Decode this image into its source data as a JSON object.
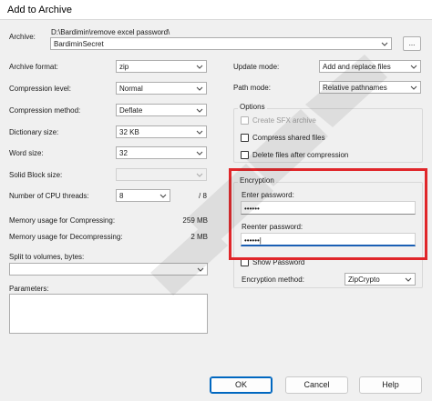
{
  "window": {
    "title": "Add to Archive"
  },
  "archive": {
    "label": "Archive:",
    "path": "D:\\Bardimin\\remove excel password\\",
    "name": "BardiminSecret",
    "browse_label": "..."
  },
  "left": {
    "format_label": "Archive format:",
    "format_value": "zip",
    "level_label": "Compression level:",
    "level_value": "Normal",
    "method_label": "Compression method:",
    "method_value": "Deflate",
    "dict_label": "Dictionary size:",
    "dict_value": "32 KB",
    "word_label": "Word size:",
    "word_value": "32",
    "solid_label": "Solid Block size:",
    "solid_value": "",
    "threads_label": "Number of CPU threads:",
    "threads_value": "8",
    "threads_total": "/ 8",
    "mem_comp_label": "Memory usage for Compressing:",
    "mem_comp_value": "259 MB",
    "mem_decomp_label": "Memory usage for Decompressing:",
    "mem_decomp_value": "2 MB",
    "split_label": "Split to volumes, bytes:",
    "split_value": "",
    "params_label": "Parameters:",
    "params_value": ""
  },
  "right": {
    "update_label": "Update mode:",
    "update_value": "Add and replace files",
    "path_label": "Path mode:",
    "path_value": "Relative pathnames",
    "options_title": "Options",
    "opt_sfx": "Create SFX archive",
    "opt_shared": "Compress shared files",
    "opt_delete": "Delete files after compression",
    "enc_title": "Encryption",
    "enter_label": "Enter password:",
    "enter_value": "••••••",
    "reenter_label": "Reenter password:",
    "reenter_value": "••••••|",
    "show_password": "Show Password",
    "enc_method_label": "Encryption method:",
    "enc_method_value": "ZipCrypto"
  },
  "buttons": {
    "ok": "OK",
    "cancel": "Cancel",
    "help": "Help"
  },
  "colors": {
    "highlight": "#e0262a",
    "focus": "#1a5fb4",
    "primary_border": "#0067c0"
  }
}
